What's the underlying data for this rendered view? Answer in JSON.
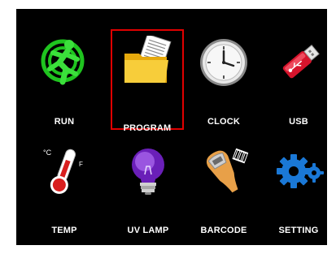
{
  "menu": {
    "selected": "PROGRAM",
    "selection_color": "#e00000",
    "items": [
      {
        "label": "RUN",
        "icon": "running-man-icon",
        "color": "#22cc22"
      },
      {
        "label": "PROGRAM",
        "icon": "folder-icon",
        "color": "#f5c518"
      },
      {
        "label": "CLOCK",
        "icon": "clock-icon",
        "color": "#cfcfcf"
      },
      {
        "label": "USB",
        "icon": "usb-drive-icon",
        "color": "#d6142c"
      },
      {
        "label": "TEMP",
        "icon": "thermometer-icon",
        "color": "#d81e1e"
      },
      {
        "label": "UV LAMP",
        "icon": "uv-lamp-icon",
        "color": "#7b2cc9"
      },
      {
        "label": "BARCODE",
        "icon": "barcode-scanner-icon",
        "color": "#e0a040"
      },
      {
        "label": "SETTING",
        "icon": "gears-icon",
        "color": "#1a78d6"
      }
    ]
  }
}
